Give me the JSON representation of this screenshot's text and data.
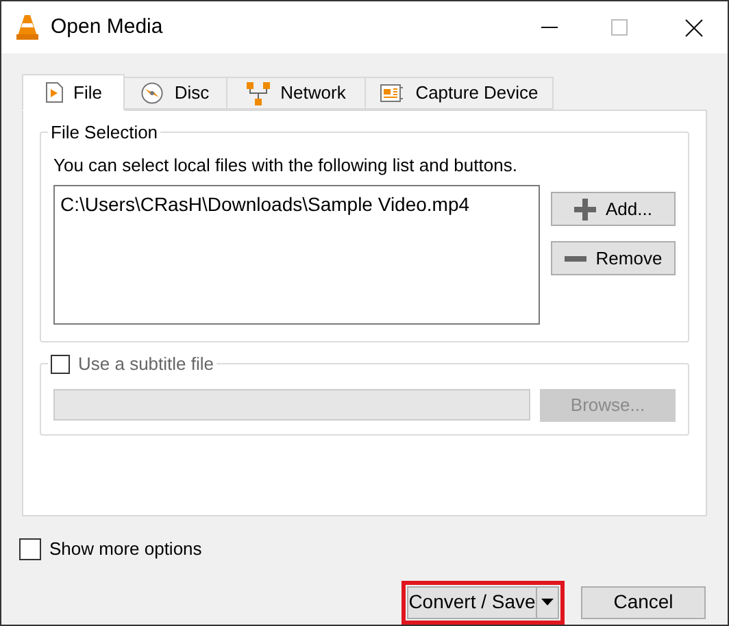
{
  "window": {
    "title": "Open Media"
  },
  "tabs": [
    {
      "label": "File",
      "selected": true
    },
    {
      "label": "Disc",
      "selected": false
    },
    {
      "label": "Network",
      "selected": false
    },
    {
      "label": "Capture Device",
      "selected": false
    }
  ],
  "file_selection": {
    "title": "File Selection",
    "hint": "You can select local files with the following list and buttons.",
    "files": [
      "C:\\Users\\CRasH\\Downloads\\Sample Video.mp4"
    ],
    "buttons": [
      {
        "label": "Add...",
        "kind": "add"
      },
      {
        "label": "Remove",
        "kind": "remove"
      }
    ]
  },
  "subtitle": {
    "label": "Use a subtitle file",
    "checked": false,
    "browse": "Browse..."
  },
  "show_more_options": {
    "label": "Show more options",
    "checked": false
  },
  "buttons": [
    {
      "label": "Convert / Save",
      "kind": "split",
      "highlighted": true
    },
    {
      "label": "Cancel",
      "kind": "plain",
      "highlighted": false
    }
  ]
}
